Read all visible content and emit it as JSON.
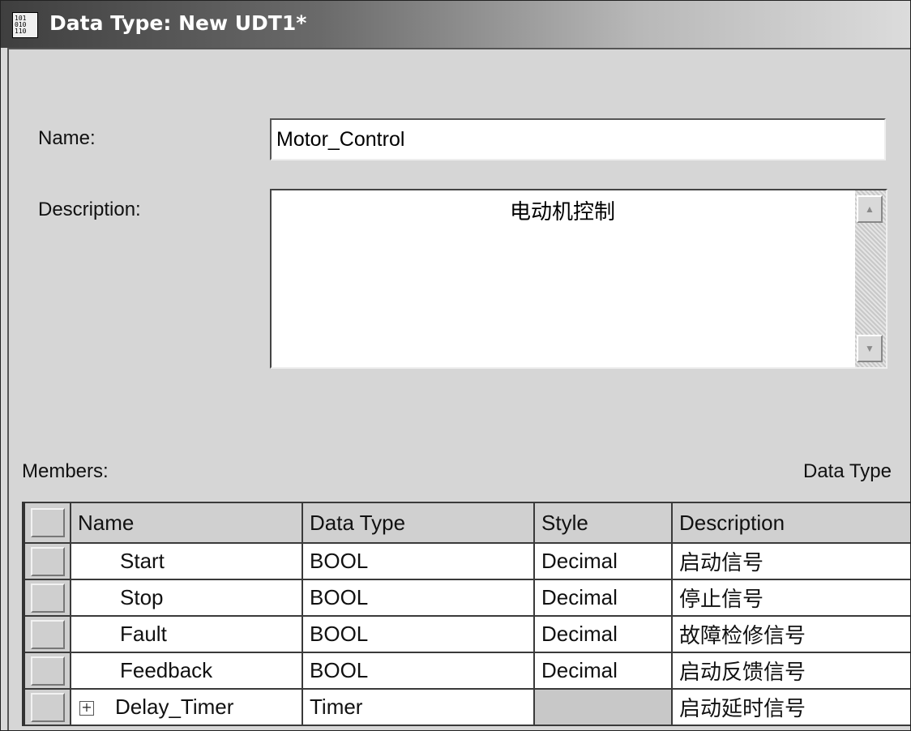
{
  "window": {
    "title": "Data Type: New UDT1*",
    "icon": "data-type-icon"
  },
  "form": {
    "name_label": "Name:",
    "name_value": "Motor_Control",
    "description_label": "Description:",
    "description_value": "电动机控制"
  },
  "members": {
    "label": "Members:",
    "right_label": "Data Type",
    "columns": [
      "Name",
      "Data Type",
      "Style",
      "Description"
    ],
    "rows": [
      {
        "name": "Start",
        "data_type": "BOOL",
        "style": "Decimal",
        "description": "启动信号"
      },
      {
        "name": "Stop",
        "data_type": "BOOL",
        "style": "Decimal",
        "description": "停止信号"
      },
      {
        "name": "Fault",
        "data_type": "BOOL",
        "style": "Decimal",
        "description": "故障检修信号"
      },
      {
        "name": "Feedback",
        "data_type": "BOOL",
        "style": "Decimal",
        "description": "启动反馈信号"
      },
      {
        "name": "Delay_Timer",
        "data_type": "Timer",
        "style": "",
        "description": "启动延时信号",
        "expandable": true
      }
    ]
  }
}
